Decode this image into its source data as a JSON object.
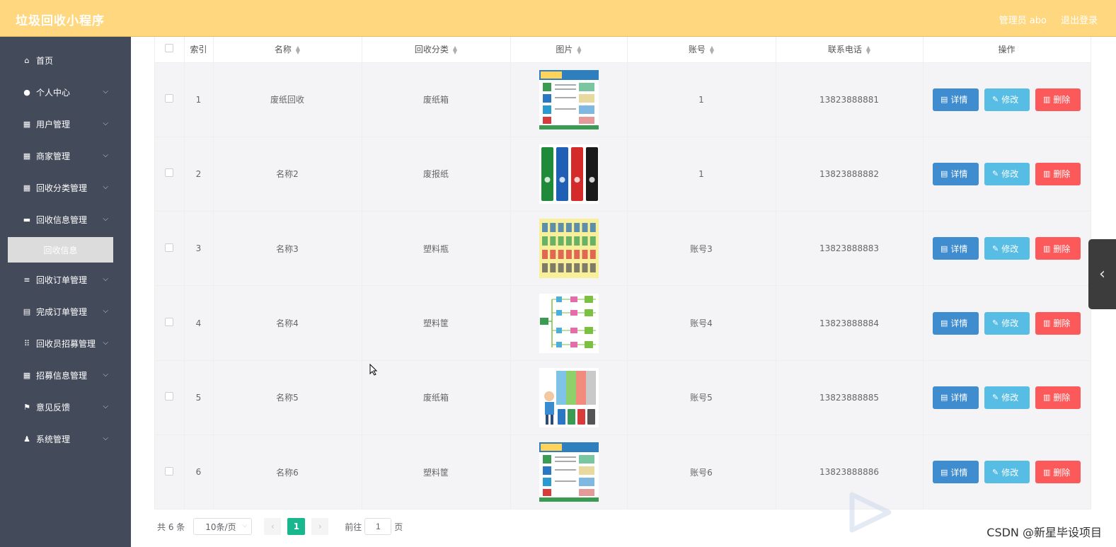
{
  "header": {
    "title": "垃圾回收小程序",
    "admin": "管理员 abo",
    "logout": "退出登录",
    "bg_color": "#ffd77f"
  },
  "sidebar": {
    "items": [
      {
        "label": "首页",
        "icon": "home-icon",
        "expandable": false
      },
      {
        "label": "个人中心",
        "icon": "user-icon",
        "expandable": true
      },
      {
        "label": "用户管理",
        "icon": "grid-icon",
        "expandable": true
      },
      {
        "label": "商家管理",
        "icon": "grid-icon",
        "expandable": true
      },
      {
        "label": "回收分类管理",
        "icon": "grid-icon",
        "expandable": true
      },
      {
        "label": "回收信息管理",
        "icon": "monitor-icon",
        "expandable": true
      },
      {
        "label": "回收订单管理",
        "icon": "sliders-icon",
        "expandable": true
      },
      {
        "label": "完成订单管理",
        "icon": "clipboard-icon",
        "expandable": true
      },
      {
        "label": "回收员招募管理",
        "icon": "apps-icon",
        "expandable": true
      },
      {
        "label": "招募信息管理",
        "icon": "grid-icon",
        "expandable": true
      },
      {
        "label": "意见反馈",
        "icon": "flag-icon",
        "expandable": true
      },
      {
        "label": "系统管理",
        "icon": "person-icon",
        "expandable": true
      }
    ],
    "active_sub": "回收信息"
  },
  "table": {
    "headers": {
      "index": "索引",
      "name": "名称",
      "category": "回收分类",
      "image": "图片",
      "account": "账号",
      "phone": "联系电话",
      "actions": "操作"
    },
    "rows": [
      {
        "index": "1",
        "name": "废纸回收",
        "category": "废纸箱",
        "image": "poster-chart",
        "account": "1",
        "phone": "13823888881"
      },
      {
        "index": "2",
        "name": "名称2",
        "category": "废报纸",
        "image": "four-bins",
        "account": "1",
        "phone": "13823888882"
      },
      {
        "index": "3",
        "name": "名称3",
        "category": "塑料瓶",
        "image": "icon-grid",
        "account": "账号3",
        "phone": "13823888883"
      },
      {
        "index": "4",
        "name": "名称4",
        "category": "塑料筐",
        "image": "flow-diagram",
        "account": "账号4",
        "phone": "13823888884"
      },
      {
        "index": "5",
        "name": "名称5",
        "category": "废纸箱",
        "image": "kid-bins",
        "account": "账号5",
        "phone": "13823888885"
      },
      {
        "index": "6",
        "name": "名称6",
        "category": "塑料筐",
        "image": "poster-chart",
        "account": "账号6",
        "phone": "13823888886"
      }
    ],
    "actions": {
      "detail": "详情",
      "edit": "修改",
      "delete": "删除"
    }
  },
  "pager": {
    "total": "共 6 条",
    "page_size": "10条/页",
    "current": "1",
    "goto_prefix": "前往",
    "goto_value": "1",
    "goto_suffix": "页"
  },
  "watermark": "CSDN @新星毕设项目"
}
